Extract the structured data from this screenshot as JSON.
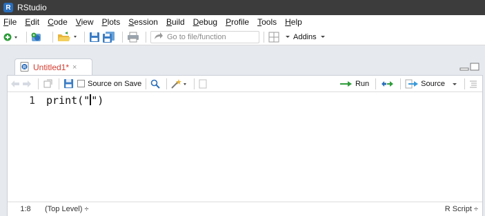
{
  "window": {
    "title": "RStudio",
    "logo_letter": "R"
  },
  "menubar": {
    "items": [
      {
        "key": "F",
        "rest": "ile"
      },
      {
        "key": "E",
        "rest": "dit"
      },
      {
        "key": "C",
        "rest": "ode"
      },
      {
        "key": "V",
        "rest": "iew"
      },
      {
        "key": "P",
        "rest": "lots"
      },
      {
        "key": "S",
        "rest": "ession"
      },
      {
        "key": "B",
        "rest": "uild"
      },
      {
        "key": "D",
        "rest": "ebug"
      },
      {
        "key": "P",
        "rest": "rofile"
      },
      {
        "key": "T",
        "rest": "ools"
      },
      {
        "key": "H",
        "rest": "elp"
      }
    ]
  },
  "toolbar": {
    "goto_placeholder": "Go to file/function",
    "addins_label": "Addins"
  },
  "editor": {
    "tab_label": "Untitled1*",
    "tab_close": "×",
    "source_on_save_label": "Source on Save",
    "run_label": "Run",
    "source_label": "Source",
    "line_number": "1",
    "code_before_cursor": "print(\"",
    "code_after_cursor": "\")"
  },
  "status": {
    "position": "1:8",
    "scope": "(Top Level) ÷",
    "file_type": "R Script ÷"
  },
  "colors": {
    "accent_blue": "#2a6ebb",
    "tab_modified_red": "#d33b2f",
    "run_green": "#2e9d3a"
  }
}
